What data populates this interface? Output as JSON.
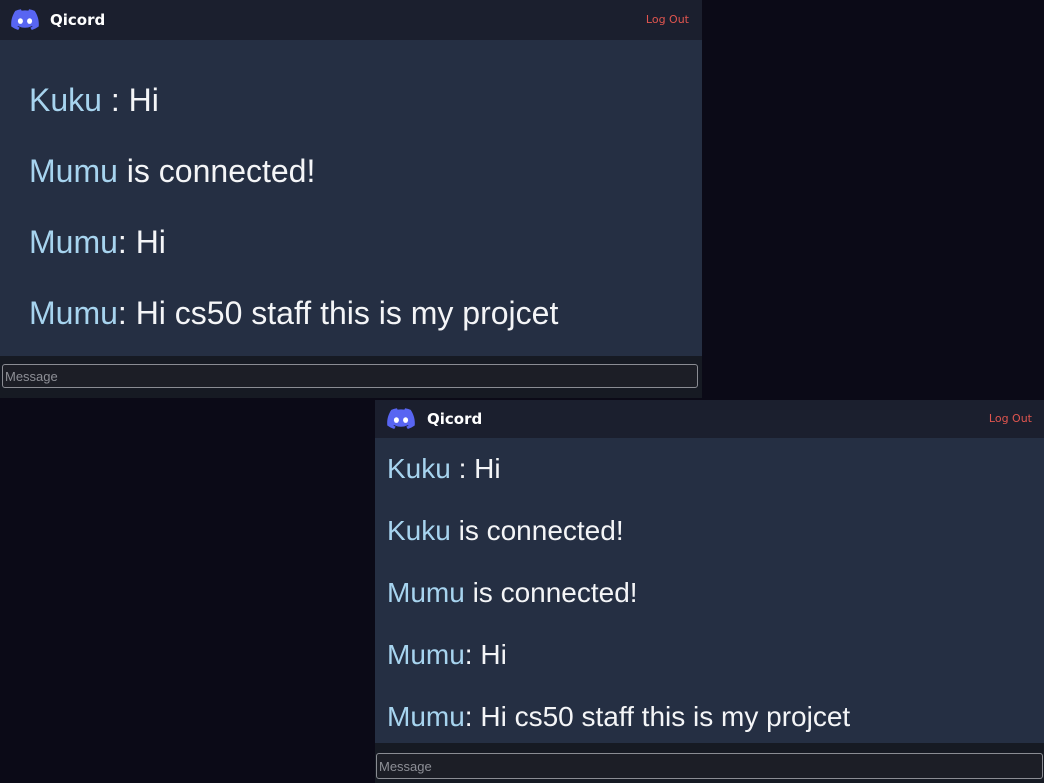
{
  "colors": {
    "background": "#0b0a17",
    "panel": "#252f43",
    "navbar": "#1b1f2e",
    "username": "#a7d4ef",
    "message_text": "#f4f5f7",
    "logout": "#e0554f",
    "logo": "#5865f2"
  },
  "windows": [
    {
      "navbar": {
        "logo_icon": "discord-logo-icon",
        "brand": "Qicord",
        "logout_label": "Log Out"
      },
      "messages": [
        {
          "user": "Kuku",
          "text": " : Hi"
        },
        {
          "user": "Mumu",
          "text": " is connected!"
        },
        {
          "user": "Mumu",
          "text": ": Hi"
        },
        {
          "user": "Mumu",
          "text": ": Hi cs50 staff this is my projcet"
        }
      ],
      "input": {
        "placeholder": "Message",
        "value": ""
      }
    },
    {
      "navbar": {
        "logo_icon": "discord-logo-icon",
        "brand": "Qicord",
        "logout_label": "Log Out"
      },
      "messages": [
        {
          "user": "Kuku",
          "text": " : Hi"
        },
        {
          "user": "Kuku",
          "text": " is connected!"
        },
        {
          "user": "Mumu",
          "text": " is connected!"
        },
        {
          "user": "Mumu",
          "text": ": Hi"
        },
        {
          "user": "Mumu",
          "text": ": Hi cs50 staff this is my projcet"
        }
      ],
      "input": {
        "placeholder": "Message",
        "value": ""
      }
    }
  ]
}
